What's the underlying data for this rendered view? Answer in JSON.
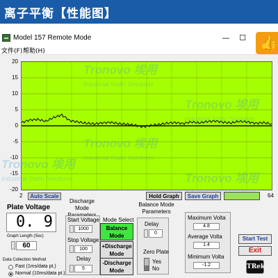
{
  "banner": {
    "title": "离子平衡【性能图】"
  },
  "window": {
    "title": "Model 157 Remote Mode",
    "minimize": "—",
    "maximize": "☐",
    "close": "✕"
  },
  "menu": {
    "file": "文件(F)",
    "help": "帮助(H)"
  },
  "thumb": {
    "icon": "thumbs-up-icon"
  },
  "watermark": {
    "brand": "Tronovo",
    "brand_cn": "埃用",
    "sub": "Industrial Static Solutions"
  },
  "graph": {
    "y_ticks": [
      "20",
      "15",
      "10",
      "5",
      "0",
      "-5",
      "-10",
      "-15",
      "-20"
    ],
    "x_min": "2",
    "x_max": "64",
    "auto_scale": "Auto Scale",
    "hold_graph": "Hold Graph",
    "save_graph": "Save Graph",
    "third_btn": "",
    "colors": {
      "plot_bg": "#a6ff00",
      "trace": "#111111"
    }
  },
  "chart_data": {
    "type": "line",
    "x_range": [
      2,
      64
    ],
    "ylim": [
      -20,
      20
    ],
    "grid": true,
    "x": [
      2,
      4,
      6,
      8,
      10,
      12,
      14,
      16,
      18,
      20,
      22,
      24,
      26,
      28,
      30,
      32,
      34,
      36,
      38,
      40,
      42,
      44,
      46,
      48,
      50,
      52,
      54,
      56,
      58,
      60,
      62,
      64
    ],
    "series": [
      {
        "values": [
          1.0,
          1.8,
          2.0,
          1.4,
          2.6,
          3.4,
          1.6,
          1.2,
          0.8,
          0.6,
          0.9,
          1.1,
          0.7,
          0.5,
          0.2,
          -0.3,
          0.1,
          0.4,
          0.8,
          1.0,
          0.7,
          1.2,
          0.9,
          1.3,
          1.5,
          1.1,
          0.9,
          1.4,
          1.2,
          0.8,
          1.0,
          0.6
        ]
      }
    ]
  },
  "plate_voltage": {
    "label": "Plate Voltage",
    "value": "0. 9",
    "graph_length_label": "Graph Length (Sec)",
    "graph_length_value": "60",
    "collection_label": "Data Collection Method",
    "opt_fast": "Fast (1ms/data pt.)",
    "opt_normal": "Normal (10ms/data pt.)"
  },
  "discharge": {
    "title": "Discharge Mode Parameters",
    "start_label": "Start Voltage",
    "start_value": "1000",
    "stop_label": "Stop Voltage",
    "stop_value": "100",
    "delay_label": "Delay",
    "delay_value": "5"
  },
  "mode_select": {
    "label": "Mode Select",
    "balance": "Balance Mode",
    "plus_discharge": "+Discharge Mode",
    "minus_discharge": "-Discharge Mode"
  },
  "balance": {
    "title": "Balance Mode Parameters",
    "delay_label": "Delay",
    "delay_value": "0",
    "zero_plate_label": "Zero Plate",
    "yes": "Yes",
    "no": "No"
  },
  "stats": {
    "max_label": "Maximum Volta",
    "max_value": "4.8",
    "avg_label": "Average Volta",
    "avg_value": "1.4",
    "min_label": "Minimum Volta",
    "min_value": "-1.2"
  },
  "actions": {
    "start": "Start Test",
    "exit": "Exit",
    "logo": "TRek"
  }
}
